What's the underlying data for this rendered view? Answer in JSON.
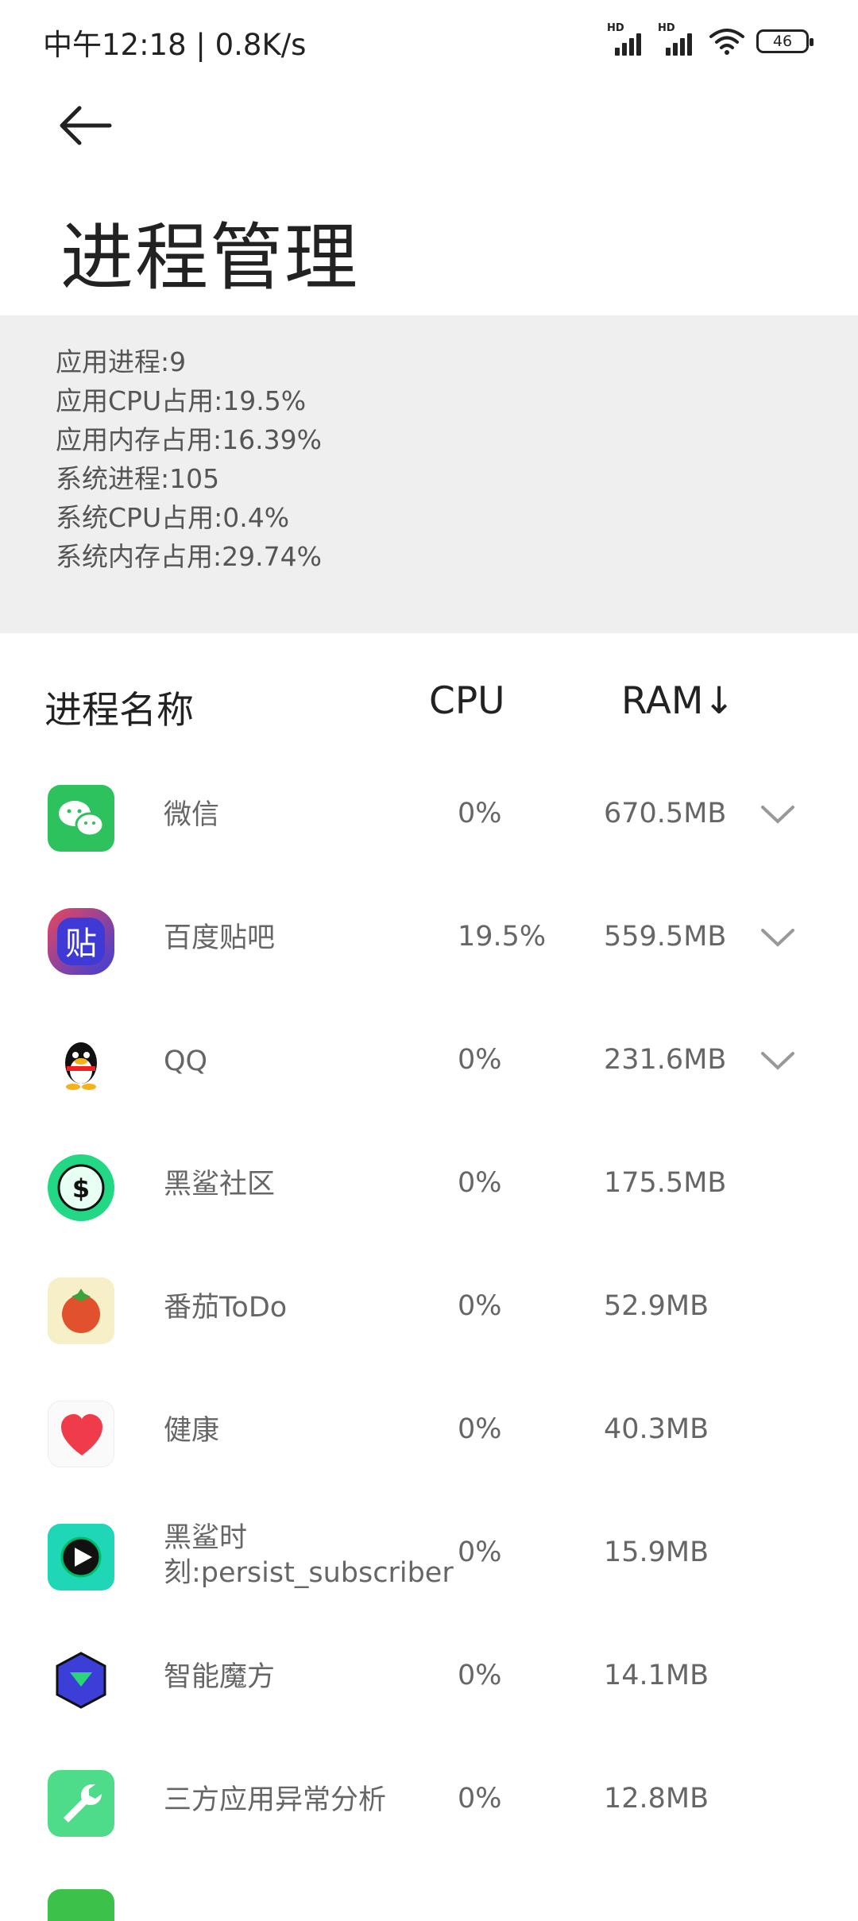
{
  "status_bar": {
    "time_speed": "中午12:18 | 0.8K/s",
    "signal_label": "HD",
    "battery": "46"
  },
  "header": {
    "title": "进程管理"
  },
  "summary": {
    "app_processes": "应用进程:9",
    "app_cpu": "应用CPU占用:19.5%",
    "app_memory": "应用内存占用:16.39%",
    "system_processes": "系统进程:105",
    "system_cpu": "系统CPU占用:0.4%",
    "system_memory": "系统内存占用:29.74%"
  },
  "table": {
    "headers": {
      "name": "进程名称",
      "cpu": "CPU",
      "ram": "RAM↓"
    },
    "rows": [
      {
        "icon": "wechat-icon",
        "name": "微信",
        "cpu": "0%",
        "ram": "670.5MB",
        "expandable": true
      },
      {
        "icon": "baidu-tieba-icon",
        "name": "百度贴吧",
        "cpu": "19.5%",
        "ram": "559.5MB",
        "expandable": true
      },
      {
        "icon": "qq-icon",
        "name": "QQ",
        "cpu": "0%",
        "ram": "231.6MB",
        "expandable": true
      },
      {
        "icon": "blackshark-community-icon",
        "name": "黑鲨社区",
        "cpu": "0%",
        "ram": "175.5MB",
        "expandable": false
      },
      {
        "icon": "tomato-todo-icon",
        "name": "番茄ToDo",
        "cpu": "0%",
        "ram": "52.9MB",
        "expandable": false
      },
      {
        "icon": "health-heart-icon",
        "name": "健康",
        "cpu": "0%",
        "ram": "40.3MB",
        "expandable": false
      },
      {
        "icon": "blackshark-moment-icon",
        "name_line1": "黑鲨时",
        "name_line2": "刻:persist_subscriber",
        "cpu": "0%",
        "ram": "15.9MB",
        "expandable": false
      },
      {
        "icon": "smart-cube-icon",
        "name": "智能魔方",
        "cpu": "0%",
        "ram": "14.1MB",
        "expandable": false
      },
      {
        "icon": "wrench-analysis-icon",
        "name": "三方应用异常分析",
        "cpu": "0%",
        "ram": "12.8MB",
        "expandable": false
      }
    ]
  }
}
